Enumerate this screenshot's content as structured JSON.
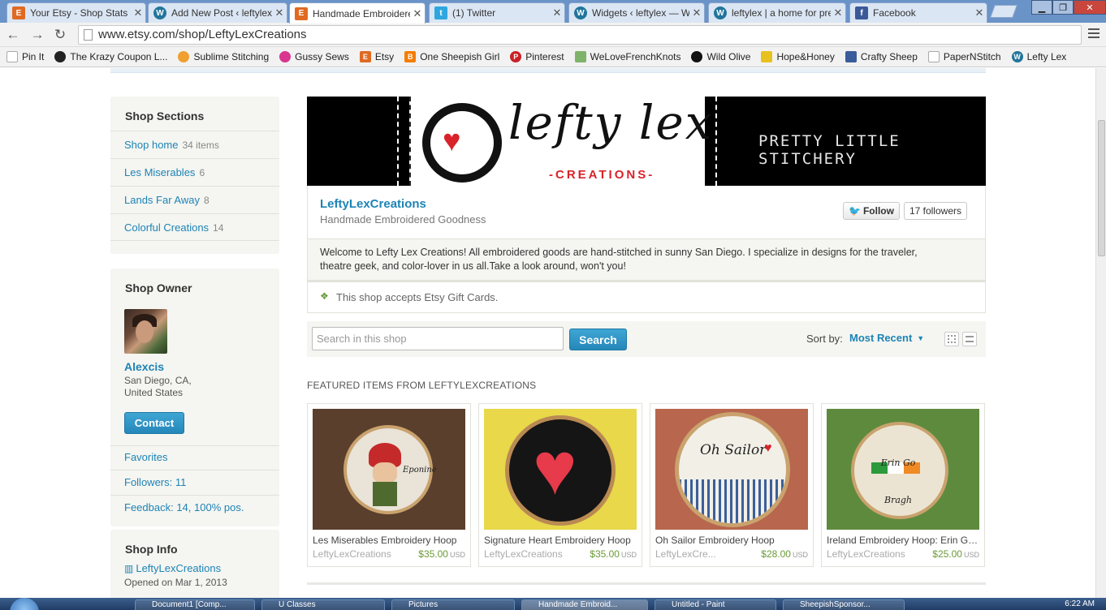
{
  "browser": {
    "tabs": [
      {
        "label": "Your Etsy - Shop Stats",
        "icon": "etsy-icon",
        "active": false
      },
      {
        "label": "Add New Post ‹ leftylex",
        "icon": "wordpress-icon",
        "active": false
      },
      {
        "label": "Handmade Embroidered",
        "icon": "etsy-icon",
        "active": true
      },
      {
        "label": "(1) Twitter",
        "icon": "twitter-icon",
        "active": false
      },
      {
        "label": "Widgets ‹ leftylex — WordPress",
        "icon": "wordpress-icon",
        "active": false
      },
      {
        "label": "leftylex | a home for pretty",
        "icon": "wordpress-icon",
        "active": false
      },
      {
        "label": "Facebook",
        "icon": "facebook-icon",
        "active": false
      }
    ],
    "url": "www.etsy.com/shop/LeftyLexCreations",
    "bookmarks": [
      "Pin It",
      "The Krazy Coupon L...",
      "Sublime Stitching",
      "Gussy Sews",
      "Etsy",
      "One Sheepish Girl",
      "Pinterest",
      "WeLoveFrenchKnots",
      "Wild Olive",
      "Hope&Honey",
      "Crafty Sheep",
      "PaperNStitch",
      "Lefty Lex"
    ]
  },
  "sidebar": {
    "sections_title": "Shop Sections",
    "sections": [
      {
        "label": "Shop home",
        "count": "34 items"
      },
      {
        "label": "Les Miserables",
        "count": "6"
      },
      {
        "label": "Lands Far Away",
        "count": "8"
      },
      {
        "label": "Colorful Creations",
        "count": "14"
      }
    ],
    "owner_title": "Shop Owner",
    "owner_name": "Alexcis",
    "owner_location_1": "San Diego, CA,",
    "owner_location_2": "United States",
    "contact_label": "Contact",
    "favorites": "Favorites",
    "followers": "Followers: 11",
    "feedback": "Feedback: 14, 100% pos.",
    "info_title": "Shop Info",
    "info_shop": "LeftyLexCreations",
    "info_opened": "Opened on Mar 1, 2013"
  },
  "banner": {
    "logo": "lefty lex",
    "logo_sub": "-CREATIONS-",
    "tagline": "PRETTY LITTLE STITCHERY"
  },
  "shop": {
    "name": "LeftyLexCreations",
    "subtitle": "Handmade Embroidered Goodness",
    "follow_label": "Follow",
    "followers": "17 followers",
    "welcome": "Welcome to Lefty Lex Creations! All embroidered goods are hand-stitched in sunny San Diego. I specialize in designs for the traveler, theatre geek, and color-lover in us all.Take a look around, won't you!",
    "gift_cards": "This shop accepts Etsy Gift Cards."
  },
  "search": {
    "placeholder": "Search in this shop",
    "button": "Search",
    "sort_label": "Sort by:",
    "sort_value": "Most Recent"
  },
  "featured_heading": "FEATURED ITEMS FROM LEFTYLEXCREATIONS",
  "items": [
    {
      "title": "Les Miserables Embroidery Hoop",
      "shop": "LeftyLexCreations",
      "price": "$35.00",
      "currency": "USD"
    },
    {
      "title": "Signature Heart Embroidery Hoop",
      "shop": "LeftyLexCreations",
      "price": "$35.00",
      "currency": "USD"
    },
    {
      "title": "Oh Sailor Embroidery Hoop",
      "shop": "LeftyLexCre...",
      "price": "$28.00",
      "currency": "USD"
    },
    {
      "title": "Ireland Embroidery Hoop: Erin Go Bragh",
      "shop": "LeftyLexCreations",
      "price": "$25.00",
      "currency": "USD"
    }
  ],
  "item_art": [
    {
      "bg": "#5a3f2c",
      "text": "Eponine"
    },
    {
      "bg": "#e8d84a",
      "text": ""
    },
    {
      "bg": "#b8664d",
      "text": "Oh Sailor"
    },
    {
      "bg": "#5e8a3e",
      "text": "Erin Go Bragh"
    }
  ],
  "taskbar": {
    "windows": [
      "Document1 [Comp...",
      "U Classes",
      "Pictures",
      "Handmade Embroid...",
      "Untitled - Paint",
      "SheepishSponsor..."
    ],
    "clock": "6:22 AM"
  }
}
